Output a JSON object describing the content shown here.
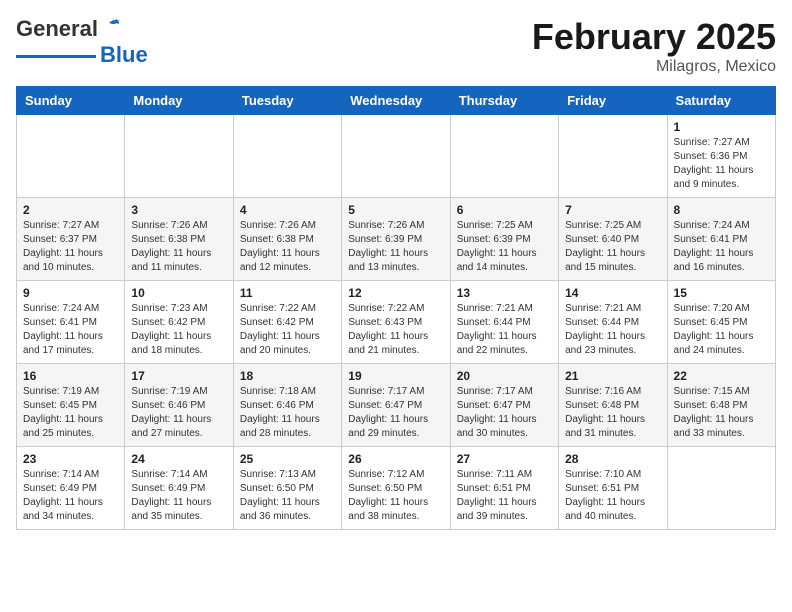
{
  "header": {
    "logo": {
      "line1": "General",
      "line2": "Blue"
    },
    "month": "February 2025",
    "location": "Milagros, Mexico"
  },
  "weekdays": [
    "Sunday",
    "Monday",
    "Tuesday",
    "Wednesday",
    "Thursday",
    "Friday",
    "Saturday"
  ],
  "weeks": [
    [
      {
        "day": "",
        "info": ""
      },
      {
        "day": "",
        "info": ""
      },
      {
        "day": "",
        "info": ""
      },
      {
        "day": "",
        "info": ""
      },
      {
        "day": "",
        "info": ""
      },
      {
        "day": "",
        "info": ""
      },
      {
        "day": "1",
        "info": "Sunrise: 7:27 AM\nSunset: 6:36 PM\nDaylight: 11 hours\nand 9 minutes."
      }
    ],
    [
      {
        "day": "2",
        "info": "Sunrise: 7:27 AM\nSunset: 6:37 PM\nDaylight: 11 hours\nand 10 minutes."
      },
      {
        "day": "3",
        "info": "Sunrise: 7:26 AM\nSunset: 6:38 PM\nDaylight: 11 hours\nand 11 minutes."
      },
      {
        "day": "4",
        "info": "Sunrise: 7:26 AM\nSunset: 6:38 PM\nDaylight: 11 hours\nand 12 minutes."
      },
      {
        "day": "5",
        "info": "Sunrise: 7:26 AM\nSunset: 6:39 PM\nDaylight: 11 hours\nand 13 minutes."
      },
      {
        "day": "6",
        "info": "Sunrise: 7:25 AM\nSunset: 6:39 PM\nDaylight: 11 hours\nand 14 minutes."
      },
      {
        "day": "7",
        "info": "Sunrise: 7:25 AM\nSunset: 6:40 PM\nDaylight: 11 hours\nand 15 minutes."
      },
      {
        "day": "8",
        "info": "Sunrise: 7:24 AM\nSunset: 6:41 PM\nDaylight: 11 hours\nand 16 minutes."
      }
    ],
    [
      {
        "day": "9",
        "info": "Sunrise: 7:24 AM\nSunset: 6:41 PM\nDaylight: 11 hours\nand 17 minutes."
      },
      {
        "day": "10",
        "info": "Sunrise: 7:23 AM\nSunset: 6:42 PM\nDaylight: 11 hours\nand 18 minutes."
      },
      {
        "day": "11",
        "info": "Sunrise: 7:22 AM\nSunset: 6:42 PM\nDaylight: 11 hours\nand 20 minutes."
      },
      {
        "day": "12",
        "info": "Sunrise: 7:22 AM\nSunset: 6:43 PM\nDaylight: 11 hours\nand 21 minutes."
      },
      {
        "day": "13",
        "info": "Sunrise: 7:21 AM\nSunset: 6:44 PM\nDaylight: 11 hours\nand 22 minutes."
      },
      {
        "day": "14",
        "info": "Sunrise: 7:21 AM\nSunset: 6:44 PM\nDaylight: 11 hours\nand 23 minutes."
      },
      {
        "day": "15",
        "info": "Sunrise: 7:20 AM\nSunset: 6:45 PM\nDaylight: 11 hours\nand 24 minutes."
      }
    ],
    [
      {
        "day": "16",
        "info": "Sunrise: 7:19 AM\nSunset: 6:45 PM\nDaylight: 11 hours\nand 25 minutes."
      },
      {
        "day": "17",
        "info": "Sunrise: 7:19 AM\nSunset: 6:46 PM\nDaylight: 11 hours\nand 27 minutes."
      },
      {
        "day": "18",
        "info": "Sunrise: 7:18 AM\nSunset: 6:46 PM\nDaylight: 11 hours\nand 28 minutes."
      },
      {
        "day": "19",
        "info": "Sunrise: 7:17 AM\nSunset: 6:47 PM\nDaylight: 11 hours\nand 29 minutes."
      },
      {
        "day": "20",
        "info": "Sunrise: 7:17 AM\nSunset: 6:47 PM\nDaylight: 11 hours\nand 30 minutes."
      },
      {
        "day": "21",
        "info": "Sunrise: 7:16 AM\nSunset: 6:48 PM\nDaylight: 11 hours\nand 31 minutes."
      },
      {
        "day": "22",
        "info": "Sunrise: 7:15 AM\nSunset: 6:48 PM\nDaylight: 11 hours\nand 33 minutes."
      }
    ],
    [
      {
        "day": "23",
        "info": "Sunrise: 7:14 AM\nSunset: 6:49 PM\nDaylight: 11 hours\nand 34 minutes."
      },
      {
        "day": "24",
        "info": "Sunrise: 7:14 AM\nSunset: 6:49 PM\nDaylight: 11 hours\nand 35 minutes."
      },
      {
        "day": "25",
        "info": "Sunrise: 7:13 AM\nSunset: 6:50 PM\nDaylight: 11 hours\nand 36 minutes."
      },
      {
        "day": "26",
        "info": "Sunrise: 7:12 AM\nSunset: 6:50 PM\nDaylight: 11 hours\nand 38 minutes."
      },
      {
        "day": "27",
        "info": "Sunrise: 7:11 AM\nSunset: 6:51 PM\nDaylight: 11 hours\nand 39 minutes."
      },
      {
        "day": "28",
        "info": "Sunrise: 7:10 AM\nSunset: 6:51 PM\nDaylight: 11 hours\nand 40 minutes."
      },
      {
        "day": "",
        "info": ""
      }
    ]
  ]
}
